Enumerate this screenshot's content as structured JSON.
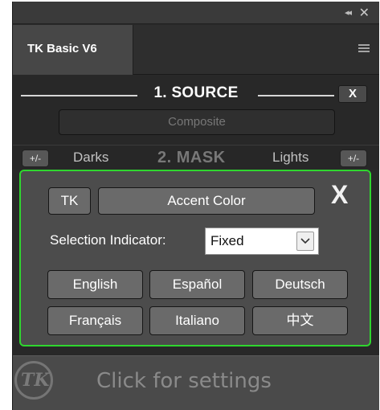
{
  "window": {
    "collapse_glyph": "◂◂",
    "close_glyph": "✕",
    "tab_title": "TK Basic V6",
    "menu_icon": "hamburger-icon"
  },
  "source": {
    "title": "1. SOURCE",
    "clear_label": "X",
    "value": "Composite"
  },
  "mask": {
    "minus_label": "+/-",
    "darks_label": "Darks",
    "title": "2. MASK",
    "lights_label": "Lights",
    "plus_label": "+/-"
  },
  "settings": {
    "border_color": "#2fd62f",
    "tk_label": "TK",
    "accent_label": "Accent Color",
    "close_label": "X",
    "selection_label": "Selection Indicator:",
    "selection_value": "Fixed",
    "languages": [
      "English",
      "Español",
      "Deutsch",
      "Français",
      "Italiano",
      "中文"
    ]
  },
  "footer": {
    "logo_text": "TK",
    "label": "Click for settings"
  }
}
